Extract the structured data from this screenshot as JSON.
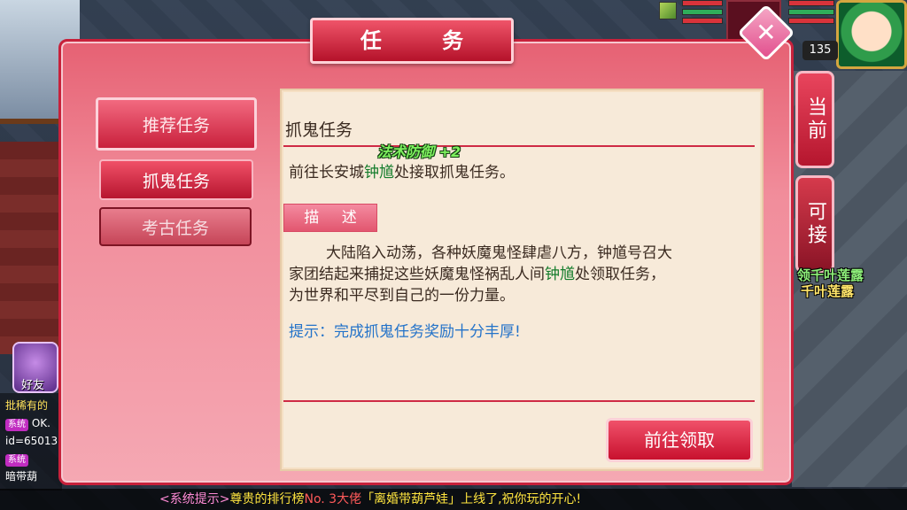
{
  "dialog": {
    "title": "任 务",
    "close_glyph": "✕"
  },
  "categories": [
    {
      "label": "推荐任务",
      "state": "active"
    },
    {
      "label": "抓鬼任务",
      "state": "normal"
    },
    {
      "label": "考古任务",
      "state": "disabled"
    }
  ],
  "task": {
    "name": "抓鬼任务",
    "location_pre": "前往长安城",
    "npc": "钟馗",
    "location_post": "处接取抓鬼任务。",
    "desc_tab": "描 述",
    "desc_line1": "大陆陷入动荡，各种妖魔鬼怪肆虐八方，钟馗号召大",
    "desc_line2_pre": "家团结起来捕捉这些妖魔鬼怪祸乱人间",
    "desc_line2_npc": "钟馗",
    "desc_line2_post": "处领取任务，",
    "desc_line3": "为世界和平尽到自己的一份力量。",
    "tip": "提示：完成抓鬼任务奖励十分丰厚!",
    "action_label": "前往领取"
  },
  "floating": {
    "buff_text": "法术防御 +2",
    "right_green": "领千叶莲露",
    "right_yellow": "千叶莲露"
  },
  "side_tabs": {
    "current": "当前",
    "acceptable": "可接"
  },
  "hud": {
    "level": "135"
  },
  "left_panel": {
    "friend_label": "好友",
    "chat_line1": "批稀有的",
    "sys_tag": "系统",
    "chat_line2": "OK.",
    "chat_line3": "id=65013",
    "chat_line5": "暗带葫"
  },
  "ticker": {
    "sys": "<系统提示>",
    "text1": "尊贵的排行榜",
    "no": "No. 3",
    "name": "大佬",
    "text2": "「离婚带葫芦娃」上线了,祝你玩的开心!"
  },
  "colors": {
    "dialog_red": "#c7213b",
    "highlight_green": "#137c2b",
    "tip_blue": "#2473c9"
  }
}
